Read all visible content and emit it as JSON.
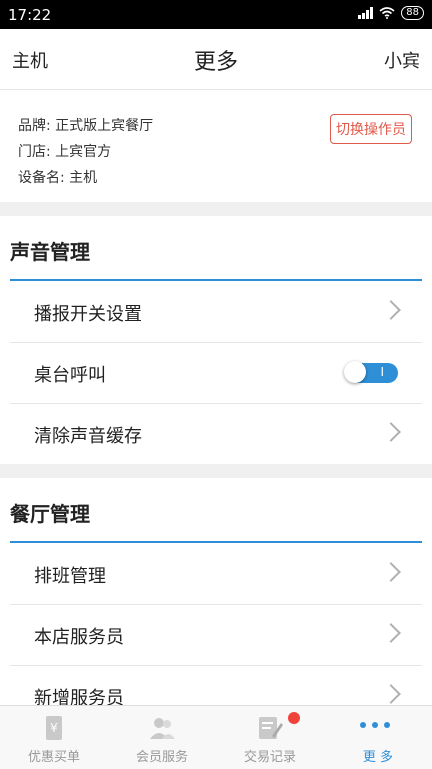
{
  "status_bar": {
    "time": "17:22",
    "battery": "88"
  },
  "header": {
    "left": "主机",
    "title": "更多",
    "right": "小宾"
  },
  "info": {
    "brand": "品牌: 正式版上宾餐厅",
    "store": "门店: 上宾官方",
    "device": "设备名: 主机",
    "switch_button": "切换操作员"
  },
  "sound_section": {
    "title": "声音管理",
    "items": [
      {
        "label": "播报开关设置",
        "control": "chevron"
      },
      {
        "label": "桌台呼叫",
        "control": "toggle",
        "toggle_on": true
      },
      {
        "label": "清除声音缓存",
        "control": "chevron"
      }
    ],
    "toggle_mark": "I"
  },
  "restaurant_section": {
    "title": "餐厅管理",
    "items": [
      {
        "label": "排班管理"
      },
      {
        "label": "本店服务员"
      },
      {
        "label": "新增服务员"
      }
    ]
  },
  "tabbar": {
    "items": [
      {
        "label": "优惠买单",
        "icon": "receipt-yen-icon"
      },
      {
        "label": "会员服务",
        "icon": "members-icon"
      },
      {
        "label": "交易记录",
        "icon": "edit-record-icon",
        "badge": true
      },
      {
        "label": "更 多",
        "icon": "more-dots-icon",
        "active": true
      }
    ]
  },
  "colors": {
    "accent": "#2e8fd6",
    "danger": "#e05a4a",
    "badge": "#f0443a"
  }
}
